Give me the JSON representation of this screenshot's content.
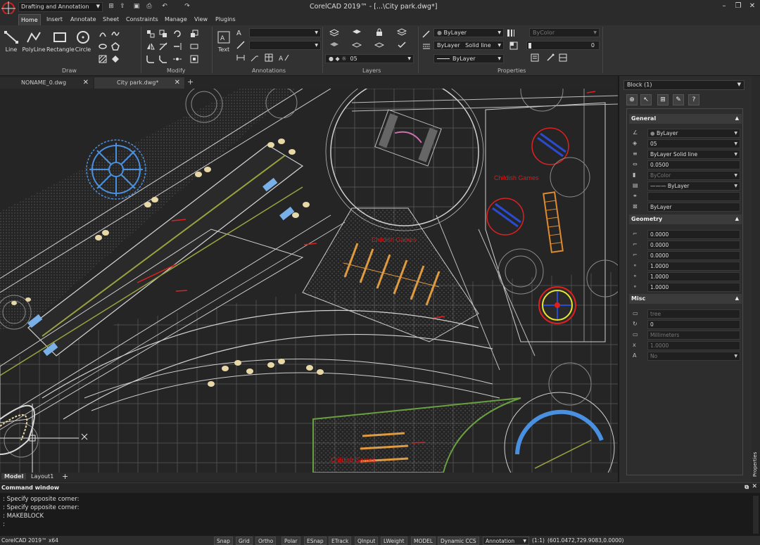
{
  "titlebar": {
    "workspace": "Drafting and Annotation",
    "window_title": "CorelCAD 2019™ - [...\\City park.dwg*]",
    "minimize": "–",
    "restore": "❐",
    "close": "✕"
  },
  "menu": {
    "items": [
      "Home",
      "Insert",
      "Annotate",
      "Sheet",
      "Constraints",
      "Manage",
      "View",
      "Plugins"
    ]
  },
  "ribbon": {
    "draw": {
      "label": "Draw",
      "line": "Line",
      "polyline": "PolyLine",
      "rectangle": "Rectangle",
      "circle": "Circle"
    },
    "modify": {
      "label": "Modify"
    },
    "annotations": {
      "label": "Annotations",
      "text": "Text"
    },
    "layers": {
      "label": "Layers",
      "current_layer": "05"
    },
    "properties": {
      "label": "Properties",
      "color": "ByLayer",
      "linetype_layer": "ByLayer",
      "linetype_style": "Solid line",
      "lineweight": "ByLayer",
      "bycolor": "ByColor",
      "transparency": "0"
    }
  },
  "doc_tabs": [
    "NONAME_0.dwg",
    "City park.dwg*"
  ],
  "doc_tab_add": "+",
  "layout_tabs": [
    "Model",
    "Layout1"
  ],
  "layout_tab_add": "+",
  "drawing": {
    "labels": [
      "Childish Games",
      "Childish Games",
      "Childish Games"
    ]
  },
  "properties_panel": {
    "selection": "Block (1)",
    "tool_help": "?",
    "side_label": "Properties",
    "general": {
      "title": "General",
      "color": "ByLayer",
      "layer": "05",
      "linetype": "ByLayer     Solid line",
      "linetype_scale": "0.0500",
      "bycolor": "ByColor",
      "lineweight": "——— ByLayer",
      "plot": "ByLayer"
    },
    "geometry": {
      "title": "Geometry",
      "values": [
        "0.0000",
        "0.0000",
        "0.0000",
        "1.0000",
        "1.0000",
        "1.0000"
      ]
    },
    "misc": {
      "title": "Misc",
      "name": "tree",
      "rotation": "0",
      "units": "Millimeters",
      "unit_factor": "1.0000",
      "annotative": "No"
    }
  },
  "command_window": {
    "title": "Command window",
    "lines": [
      ": Specify opposite corner:",
      ": Specify opposite corner:",
      ": MAKEBLOCK",
      ":"
    ]
  },
  "statusbar": {
    "app": "CorelCAD 2019™ x64",
    "buttons": [
      "Snap",
      "Grid",
      "Ortho",
      "Polar",
      "ESnap",
      "ETrack",
      "QInput",
      "LWeight",
      "MODEL",
      "Dynamic CCS"
    ],
    "annotation": "Annotation",
    "scale": "(1:1)",
    "coords": "(601.0472,729.9083,0.0000)"
  },
  "colors": {
    "canvas_bg": "#252525",
    "ribbon_bg": "#323232",
    "label_red": "#e01818",
    "tree_blue": "#4a90e0"
  }
}
